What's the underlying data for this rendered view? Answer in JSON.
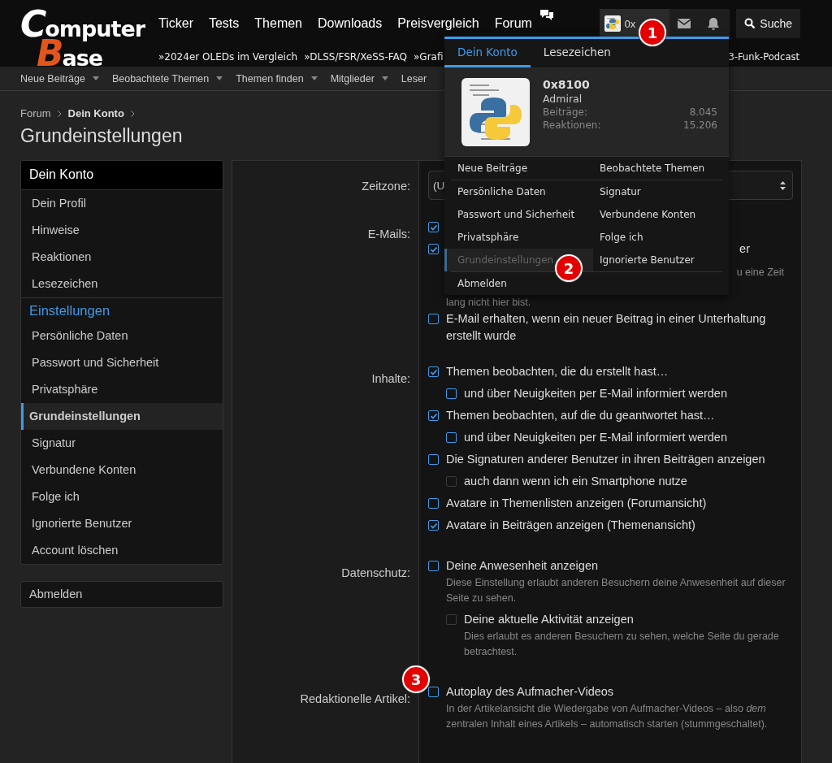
{
  "header": {
    "logo": {
      "initial1": "C",
      "rest1": "omputer",
      "initial2": "B",
      "rest2": "ase"
    },
    "nav": [
      "Ticker",
      "Tests",
      "Themen",
      "Downloads",
      "Preisvergleich",
      "Forum"
    ],
    "user_button": {
      "name": "0x"
    },
    "search_button": {
      "label": "Suche"
    },
    "ticker": [
      "»2024er OLEDs im Vergleich",
      "»DLSS/FSR/XeSS-FAQ",
      "»Grafi"
    ],
    "ticker_right": "3-Funk-Podcast"
  },
  "subnav": [
    {
      "label": "Neue Beiträge",
      "caret": true
    },
    {
      "label": "Beobachtete Themen",
      "caret": true
    },
    {
      "label": "Themen finden",
      "caret": true
    },
    {
      "label": "Mitglieder",
      "caret": true
    },
    {
      "label": "Leser",
      "caret": false
    }
  ],
  "breadcrumb": [
    {
      "label": "Forum",
      "bold": false
    },
    {
      "label": "Dein Konto",
      "bold": true
    }
  ],
  "title": "Grundeinstellungen",
  "sidebar": {
    "header": "Dein Konto",
    "items": [
      {
        "label": "Dein Profil",
        "selected": false
      },
      {
        "label": "Hinweise",
        "selected": false
      },
      {
        "label": "Reaktionen",
        "selected": false
      },
      {
        "label": "Lesezeichen",
        "selected": false
      }
    ],
    "section": "Einstellungen",
    "settings": [
      {
        "label": "Persönliche Daten",
        "selected": false
      },
      {
        "label": "Passwort und Sicherheit",
        "selected": false
      },
      {
        "label": "Privatsphäre",
        "selected": false
      },
      {
        "label": "Grundeinstellungen",
        "selected": true
      },
      {
        "label": "Signatur",
        "selected": false
      },
      {
        "label": "Verbundene Konten",
        "selected": false
      },
      {
        "label": "Folge ich",
        "selected": false
      },
      {
        "label": "Ignorierte Benutzer",
        "selected": false
      },
      {
        "label": "Account löschen",
        "selected": false
      }
    ],
    "logout": "Abmelden"
  },
  "form": [
    {
      "label": "Zeitzone:",
      "kind": "select",
      "value": "(U"
    },
    {
      "label": "E-Mails:",
      "kind": "checks",
      "options": [
        {
          "kind": "hidden",
          "checked": true
        },
        {
          "kind": "clipped",
          "checked": true,
          "label": "er",
          "hint_lines": [
            "u eine Zeit",
            "lang nicht hier bist."
          ]
        },
        {
          "checked": false,
          "label": "E-Mail erhalten, wenn ein neuer Beitrag in einer Unterhaltung erstellt wurde"
        }
      ]
    },
    {
      "label": "Inhalte:",
      "kind": "checks",
      "options": [
        {
          "checked": true,
          "label": "Themen beobachten, die du erstellt hast…",
          "children": [
            {
              "checked": false,
              "disabled": false,
              "label": "und über Neuigkeiten per E-Mail informiert werden"
            }
          ]
        },
        {
          "checked": true,
          "label": "Themen beobachten, auf die du geantwortet hast…",
          "children": [
            {
              "checked": false,
              "disabled": false,
              "label": "und über Neuigkeiten per E-Mail informiert werden"
            }
          ]
        },
        {
          "checked": false,
          "label": "Die Signaturen anderer Benutzer in ihren Beiträgen anzeigen",
          "children": [
            {
              "checked": false,
              "disabled": true,
              "label": "auch dann wenn ich ein Smartphone nutze"
            }
          ]
        },
        {
          "checked": false,
          "label": "Avatare in Themenlisten anzeigen (Forumansicht)"
        },
        {
          "checked": true,
          "label": "Avatare in Beiträgen anzeigen (Themenansicht)"
        }
      ]
    },
    {
      "label": "Datenschutz:",
      "kind": "checks",
      "options": [
        {
          "checked": false,
          "label": "Deine Anwesenheit anzeigen",
          "hint": "Diese Einstellung erlaubt anderen Besuchern deine Anwesenheit auf dieser Seite zu sehen.",
          "children": [
            {
              "checked": false,
              "disabled": true,
              "label": "Deine aktuelle Aktivität anzeigen",
              "hint": "Dies erlaubt es anderen Besuchern zu sehen, welche Seite du gerade betrachtest."
            }
          ]
        }
      ]
    },
    {
      "label": "Redaktionelle Artikel:",
      "kind": "checks",
      "options": [
        {
          "checked": false,
          "label": "Autoplay des Aufmacher-Videos",
          "hint": "In der Artikelansicht die Wiedergabe von Aufmacher-Videos – also *dem* zentralen Inhalt eines Artikels – automatisch starten (stummgeschaltet)."
        }
      ]
    }
  ],
  "account_menu": {
    "tabs": [
      {
        "label": "Dein Konto",
        "selected": true
      },
      {
        "label": "Lesezeichen",
        "selected": false
      }
    ],
    "user": {
      "name": "0x8100",
      "rank": "Admiral",
      "stats": [
        {
          "label": "Beiträge:",
          "value": "8.045"
        },
        {
          "label": "Reaktionen:",
          "value": "15.206"
        }
      ]
    },
    "link_groups": [
      [
        {
          "label": "Neue Beiträge",
          "selected": false
        },
        {
          "label": "Beobachtete Themen",
          "selected": false
        }
      ],
      [
        {
          "label": "Persönliche Daten",
          "selected": false
        },
        {
          "label": "Signatur",
          "selected": false
        },
        {
          "label": "Passwort und Sicherheit",
          "selected": false
        },
        {
          "label": "Verbundene Konten",
          "selected": false
        },
        {
          "label": "Privatsphäre",
          "selected": false
        },
        {
          "label": "Folge ich",
          "selected": false
        },
        {
          "label": "Grundeinstellungen",
          "selected": true
        },
        {
          "label": "Ignorierte Benutzer",
          "selected": false
        }
      ],
      [
        {
          "label": "Abmelden",
          "selected": false
        }
      ]
    ]
  },
  "callouts": [
    {
      "number": "1"
    },
    {
      "number": "2"
    },
    {
      "number": "3"
    }
  ]
}
